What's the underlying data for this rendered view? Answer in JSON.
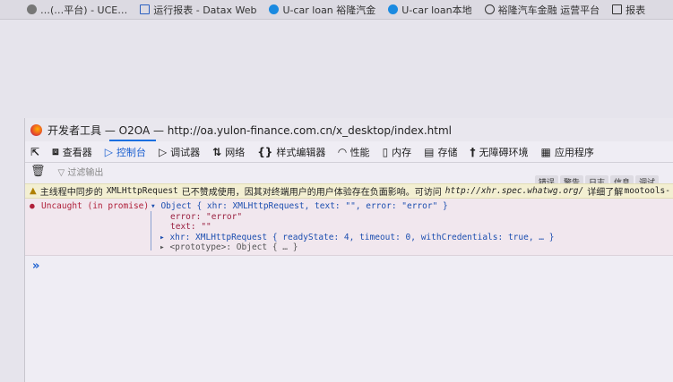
{
  "bookmarks": [
    {
      "label": "…(…平台) - UCE…",
      "icon": "globe-icon"
    },
    {
      "label": "运行报表 - Datax Web",
      "icon": "page-icon"
    },
    {
      "label": "U-car loan 裕隆汽金",
      "icon": "ucar-icon"
    },
    {
      "label": "U-car loan本地",
      "icon": "ucar-icon"
    },
    {
      "label": "裕隆汽车金融 运营平台",
      "icon": "globe-icon"
    },
    {
      "label": "报表",
      "icon": "page-icon"
    }
  ],
  "devtools": {
    "title": "开发者工具 — O2OA — http://oa.yulon-finance.com.cn/x_desktop/index.html",
    "tabs": [
      {
        "label": "查看器",
        "icon": "⧈"
      },
      {
        "label": "控制台",
        "icon": "▷",
        "active": true
      },
      {
        "label": "调试器",
        "icon": "▷"
      },
      {
        "label": "网络",
        "icon": "⇅"
      },
      {
        "label": "样式编辑器",
        "icon": "{}"
      },
      {
        "label": "性能",
        "icon": "◠"
      },
      {
        "label": "内存",
        "icon": "▯"
      },
      {
        "label": "存储",
        "icon": "▤"
      },
      {
        "label": "无障碍环境",
        "icon": "†"
      },
      {
        "label": "应用程序",
        "icon": "▦"
      }
    ],
    "filter_placeholder": "过滤输出",
    "levels": [
      "错误",
      "警告",
      "日志",
      "信息",
      "调试"
    ],
    "warning": {
      "text_before": "主线程中同步的",
      "code": "XMLHttpRequest",
      "text_after": "已不赞成使用，因其对终端用户的用户体验存在负面影响。可访问",
      "link": "http://xhr.spec.whatwg.org/",
      "more": "详细了解",
      "source": "mootools-"
    },
    "error": {
      "label": "Uncaught (in promise)",
      "summary": "Object { xhr: XMLHttpRequest, text: \"\", error: \"error\" }",
      "error_prop": "error: \"error\"",
      "text_prop": "text: \"\"",
      "xhr_prop": "xhr: XMLHttpRequest { readyState: 4, timeout: 0, withCredentials: true, … }",
      "proto_prop": "<prototype>: Object { … }"
    },
    "prompt": "»"
  }
}
